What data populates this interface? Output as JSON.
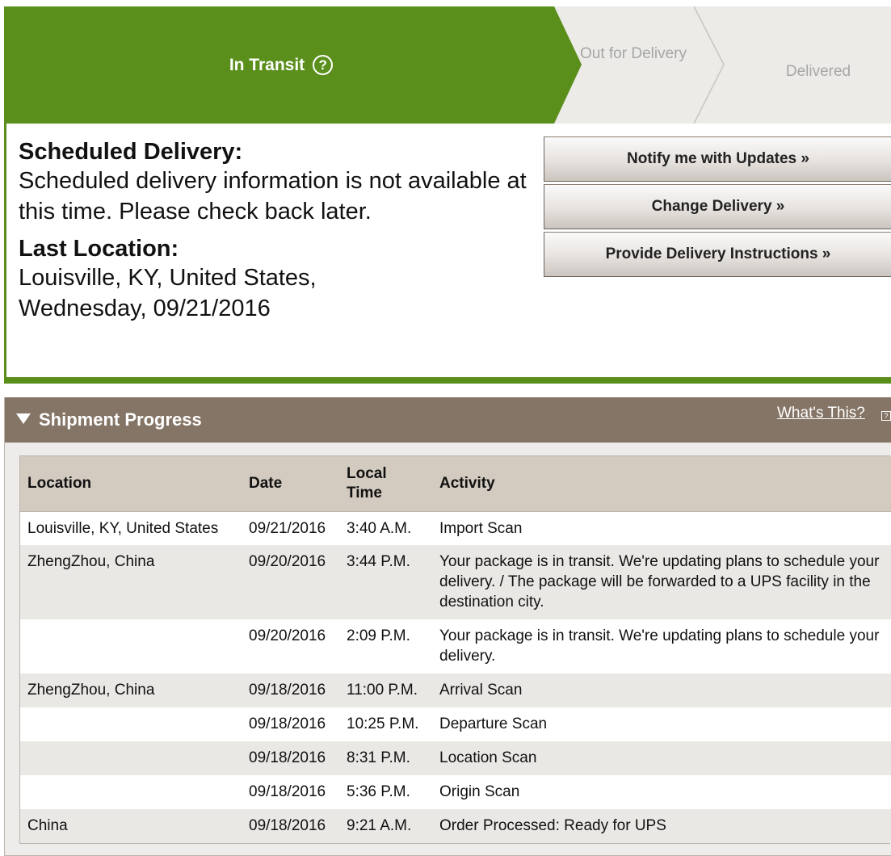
{
  "status": {
    "current_step": "In Transit",
    "help_icon": "question-circle-icon",
    "step_out_for_delivery": "Out for Delivery",
    "step_delivered": "Delivered",
    "active_color": "#5a8f1c",
    "inactive_color": "#ecebe8"
  },
  "delivery": {
    "scheduled_heading": "Scheduled Delivery:",
    "scheduled_text": "Scheduled delivery information is not available at this time. Please check back later.",
    "last_location_heading": "Last Location:",
    "last_location_text": "Louisville, KY, United States, Wednesday, 09/21/2016"
  },
  "actions": {
    "notify": "Notify me with Updates »",
    "change": "Change Delivery »",
    "instructions": "Provide Delivery Instructions »"
  },
  "shipment_progress": {
    "title": "Shipment Progress",
    "whats_this": "What's This?",
    "whats_this_icon": "help-box-icon",
    "columns": [
      "Location",
      "Date",
      "Local Time",
      "Activity"
    ],
    "rows": [
      {
        "location": "Louisville, KY, United States",
        "date": "09/21/2016",
        "time": "3:40 A.M.",
        "activity": "Import Scan"
      },
      {
        "location": "ZhengZhou, China",
        "date": "09/20/2016",
        "time": "3:44 P.M.",
        "activity": "Your package is in transit. We're updating plans to schedule your delivery. / The package will be forwarded to a UPS facility in the destination city."
      },
      {
        "location": "",
        "date": "09/20/2016",
        "time": "2:09 P.M.",
        "activity": "Your package is in transit. We're updating plans to schedule your delivery."
      },
      {
        "location": "ZhengZhou, China",
        "date": "09/18/2016",
        "time": "11:00 P.M.",
        "activity": "Arrival Scan"
      },
      {
        "location": "",
        "date": "09/18/2016",
        "time": "10:25 P.M.",
        "activity": "Departure Scan"
      },
      {
        "location": "",
        "date": "09/18/2016",
        "time": "8:31 P.M.",
        "activity": "Location Scan"
      },
      {
        "location": "",
        "date": "09/18/2016",
        "time": "5:36 P.M.",
        "activity": "Origin Scan"
      },
      {
        "location": "China",
        "date": "09/18/2016",
        "time": "9:21 A.M.",
        "activity": "Order Processed: Ready for UPS"
      }
    ]
  }
}
